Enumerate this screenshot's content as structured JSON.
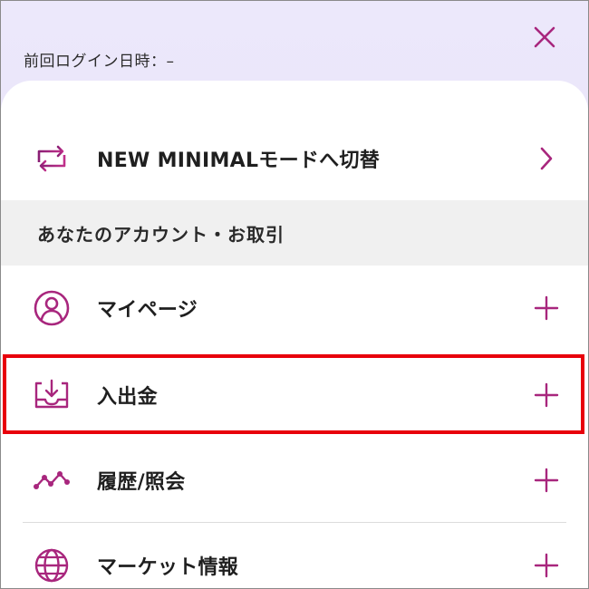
{
  "header": {
    "last_login_label": "前回ログイン日時：–"
  },
  "mode_switch": {
    "label": "NEW MINIMALモードへ切替",
    "icon": "swap-icon"
  },
  "section": {
    "title": "あなたのアカウント・お取引"
  },
  "menu": {
    "items": [
      {
        "label": "マイページ",
        "icon": "user-circle-icon"
      },
      {
        "label": "入出金",
        "icon": "deposit-tray-icon"
      },
      {
        "label": "履歴/照会",
        "icon": "line-chart-icon"
      },
      {
        "label": "マーケット情報",
        "icon": "globe-icon"
      }
    ]
  },
  "colors": {
    "accent": "#a8267d",
    "highlight": "#e8000b",
    "section_bg": "#f0f0f0",
    "header_bg": "#e8e4f9"
  }
}
